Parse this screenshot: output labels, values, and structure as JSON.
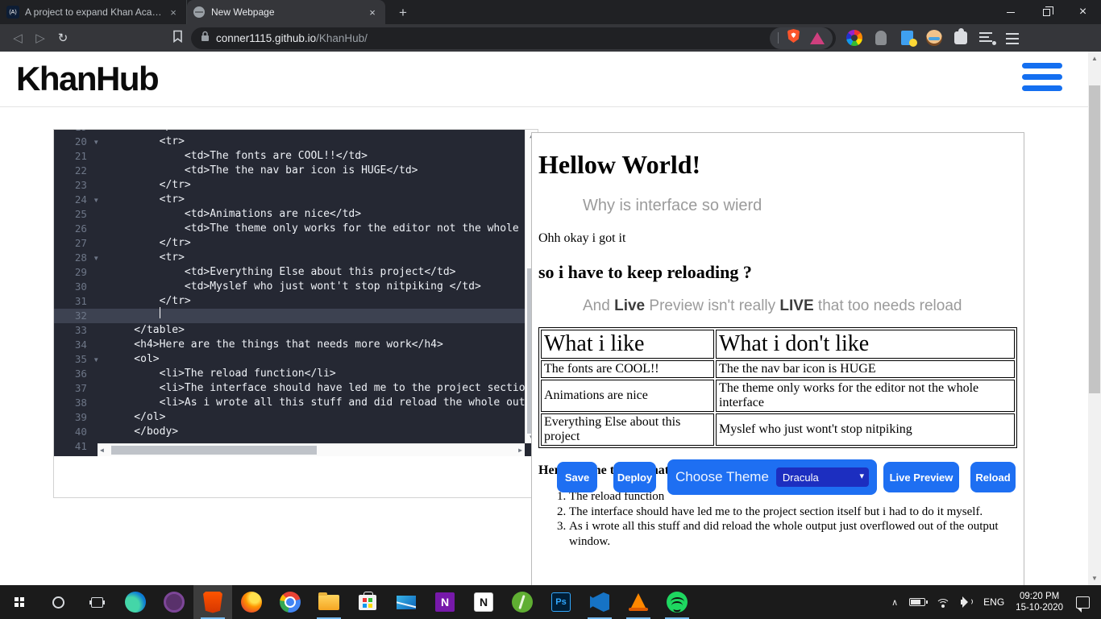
{
  "browser": {
    "tab1": {
      "title": "A project to expand Khan Academy",
      "favicon_text": "(A)"
    },
    "tab2": {
      "title": "New Webpage"
    },
    "url": {
      "host": "conner1115.github.io",
      "path": "/KhanHub/"
    }
  },
  "header": {
    "logo": "KhanHub"
  },
  "editor": {
    "lines": [
      {
        "g": "19  ",
        "c": "        </thead>"
      },
      {
        "g": "20 ▾",
        "c": "        <tr>"
      },
      {
        "g": "21  ",
        "c": "            <td>The fonts are COOL!!</td>"
      },
      {
        "g": "22  ",
        "c": "            <td>The the nav bar icon is HUGE</td>"
      },
      {
        "g": "23  ",
        "c": "        </tr>"
      },
      {
        "g": "24 ▾",
        "c": "        <tr>"
      },
      {
        "g": "25  ",
        "c": "            <td>Animations are nice</td>"
      },
      {
        "g": "26  ",
        "c": "            <td>The theme only works for the editor not the whole interface</td>"
      },
      {
        "g": "27  ",
        "c": "        </tr>"
      },
      {
        "g": "28 ▾",
        "c": "        <tr>"
      },
      {
        "g": "29  ",
        "c": "            <td>Everything Else about this project</td>"
      },
      {
        "g": "30  ",
        "c": "            <td>Myslef who just wont't stop nitpiking </td>"
      },
      {
        "g": "31  ",
        "c": "        </tr>"
      },
      {
        "g": "32  ",
        "c": "        "
      },
      {
        "g": "33  ",
        "c": "    </table>"
      },
      {
        "g": "34  ",
        "c": "    <h4>Here are the things that needs more work</h4>"
      },
      {
        "g": "35 ▾",
        "c": "    <ol>"
      },
      {
        "g": "36  ",
        "c": "        <li>The reload function</li>"
      },
      {
        "g": "37  ",
        "c": "        <li>The interface should have led me to the project section itself but i had to do it myself.</li>"
      },
      {
        "g": "38  ",
        "c": "        <li>As i wrote all this stuff and did reload the whole output just overflowed out of the output window.</li>"
      },
      {
        "g": "39  ",
        "c": "    </ol>"
      },
      {
        "g": "40  ",
        "c": "    </body>"
      },
      {
        "g": "41  ",
        "c": ""
      }
    ]
  },
  "preview": {
    "h1": "Hellow World!",
    "subtitle": "Why is interface so wierd",
    "p1": "Ohh okay i got it",
    "h2": "so i have to keep reloading ?",
    "p2": {
      "t1": "And ",
      "b1": "Live",
      "t2": " Preview isn't really ",
      "b2": "LIVE",
      "t3": " that too needs reload"
    },
    "table": {
      "headers": [
        "What i like",
        "What i don't like"
      ],
      "rows": [
        [
          "The fonts are COOL!!",
          "The the nav bar icon is HUGE"
        ],
        [
          "Animations are nice",
          "The theme only works for the editor not the whole interface"
        ],
        [
          "Everything Else about this project",
          "Myslef who just wont't stop nitpiking"
        ]
      ]
    },
    "h4": "Here are the things that needs more work",
    "list": [
      "The reload function",
      "The interface should have led me to the project section itself but i had to do it myself.",
      "As i wrote all this stuff and did reload the whole output just overflowed out of the output window."
    ]
  },
  "controls": {
    "save": "Save",
    "deploy": "Deploy",
    "choose_theme": "Choose Theme",
    "theme_selected": "Dracula",
    "live_preview": "Live Preview",
    "reload": "Reload"
  },
  "taskbar": {
    "lang": "ENG",
    "time": "09:20 PM",
    "date": "15-10-2020",
    "ps_label": "Ps",
    "onenote_letter": "N",
    "notion_letter": "N"
  },
  "icons": {
    "back": "◁",
    "forward": "▷",
    "refresh": "↻",
    "close": "×",
    "new_tab": "+",
    "up": "▲",
    "down": "▼",
    "left": "◀",
    "right": "▶",
    "chevron_down": "▾",
    "tray_chevron": "∧"
  }
}
